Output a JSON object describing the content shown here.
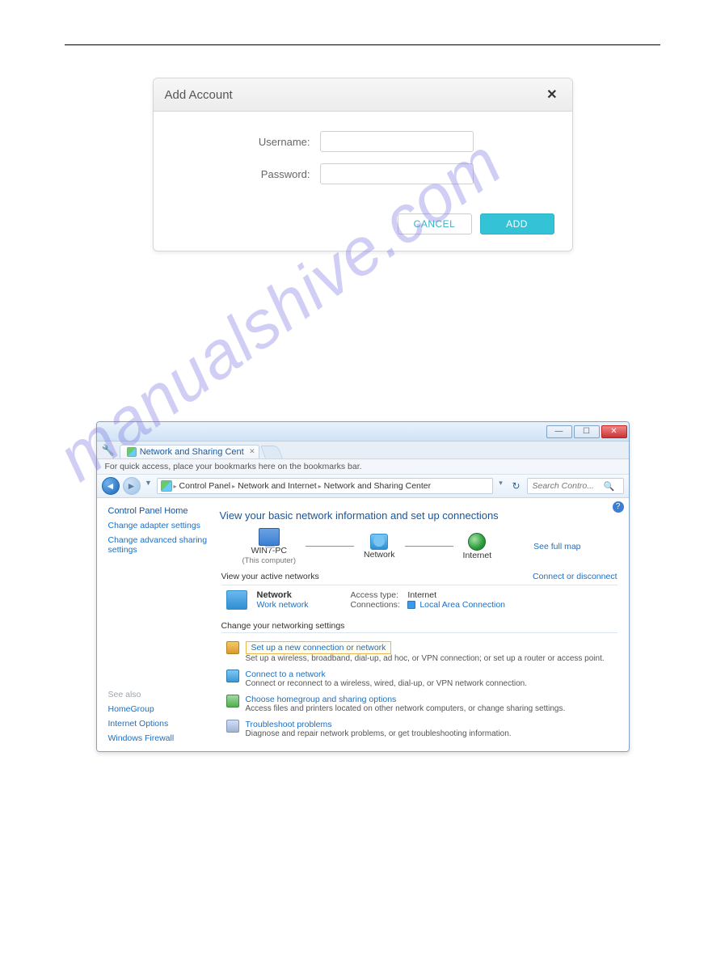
{
  "modal": {
    "title": "Add Account",
    "username_label": "Username:",
    "password_label": "Password:",
    "username_value": "",
    "password_value": "",
    "cancel": "CANCEL",
    "add": "ADD"
  },
  "watermark": "manualshive.com",
  "win": {
    "tab_title": "Network and Sharing Cent",
    "bookmark_bar": "For quick access, place your bookmarks here on the bookmarks bar.",
    "breadcrumb": {
      "a": "Control Panel",
      "b": "Network and Internet",
      "c": "Network and Sharing Center"
    },
    "search_placeholder": "Search Contro...",
    "sidebar": {
      "home": "Control Panel Home",
      "adapter": "Change adapter settings",
      "advanced": "Change advanced sharing settings",
      "seealso": "See also",
      "homegroup": "HomeGroup",
      "ioptions": "Internet Options",
      "firewall": "Windows Firewall"
    },
    "main": {
      "heading": "View your basic network information and set up connections",
      "pc_name": "WIN7-PC",
      "pc_sub": "(This computer)",
      "network_label": "Network",
      "internet_label": "Internet",
      "see_full_map": "See full map",
      "active_hdr": "View your active networks",
      "connect_disc": "Connect or disconnect",
      "net_name": "Network",
      "net_type": "Work network",
      "access_lbl": "Access type:",
      "access_val": "Internet",
      "conn_lbl": "Connections:",
      "conn_val": "Local Area Connection",
      "settings_hdr": "Change your networking settings",
      "opts": {
        "setup_t": "Set up a new connection or network",
        "setup_d": "Set up a wireless, broadband, dial-up, ad hoc, or VPN connection; or set up a router or access point.",
        "connect_t": "Connect to a network",
        "connect_d": "Connect or reconnect to a wireless, wired, dial-up, or VPN network connection.",
        "home_t": "Choose homegroup and sharing options",
        "home_d": "Access files and printers located on other network computers, or change sharing settings.",
        "trouble_t": "Troubleshoot problems",
        "trouble_d": "Diagnose and repair network problems, or get troubleshooting information."
      }
    }
  }
}
